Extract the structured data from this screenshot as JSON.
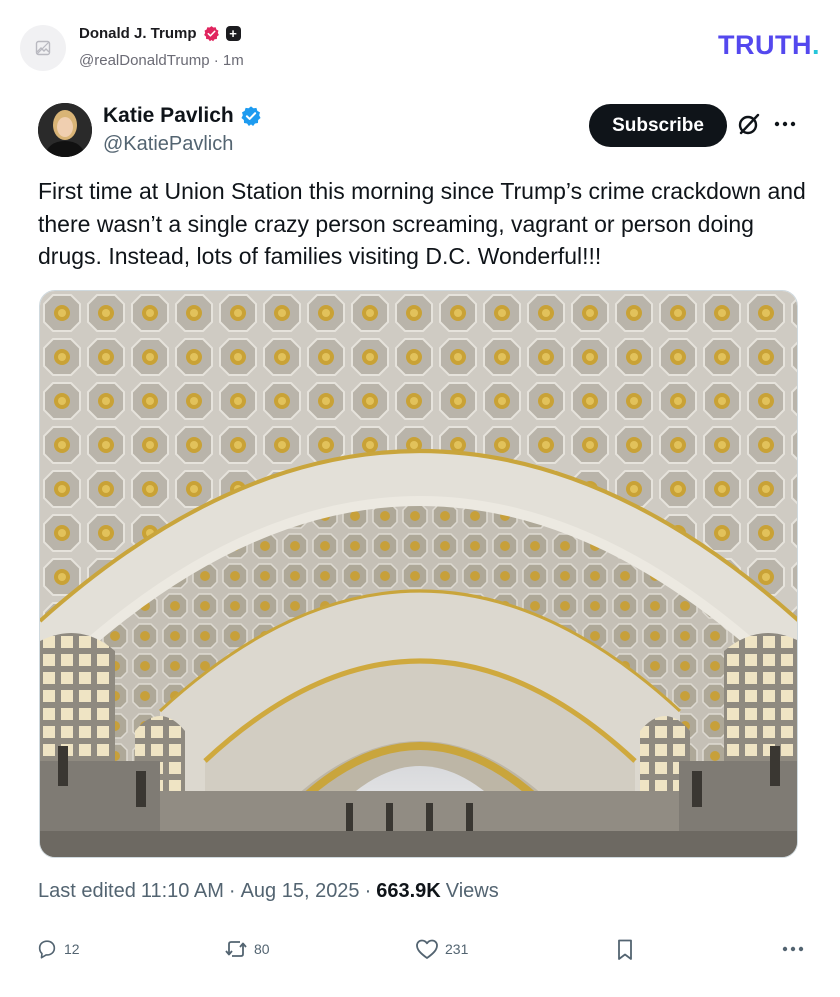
{
  "truth_header": {
    "author_name": "Donald J. Trump",
    "author_handle": "@realDonaldTrump",
    "separator": "·",
    "time_ago": "1m",
    "logo": "TRUTH",
    "logo_dot": ".",
    "verified_color": "#e0245e"
  },
  "embedded_post": {
    "author_name": "Katie Pavlich",
    "author_handle": "@KatiePavlich",
    "verified_color": "#1d9bf0",
    "subscribe_label": "Subscribe",
    "text": "First time at Union Station this morning since Trump’s crime crackdown and there wasn’t a single crazy person screaming, vagrant or person doing drugs. Instead, lots of families visiting D.C. Wonderful!!!",
    "media": {
      "description_icon": "photo",
      "subject": "Union Station vaulted ceiling"
    },
    "meta": {
      "edited_label": "Last edited",
      "time": "11:10 AM",
      "separator1": "·",
      "date": "Aug 15, 2025",
      "separator2": "·",
      "views_count": "663.9K",
      "views_label": "Views"
    },
    "actions": {
      "replies": "12",
      "reposts": "80",
      "likes": "231"
    }
  },
  "icons": {
    "avatar_placeholder": "image-placeholder-icon",
    "grok": "grok-icon",
    "more": "more-icon",
    "reply": "reply-icon",
    "repost": "repost-icon",
    "like": "heart-icon",
    "bookmark": "bookmark-icon"
  }
}
